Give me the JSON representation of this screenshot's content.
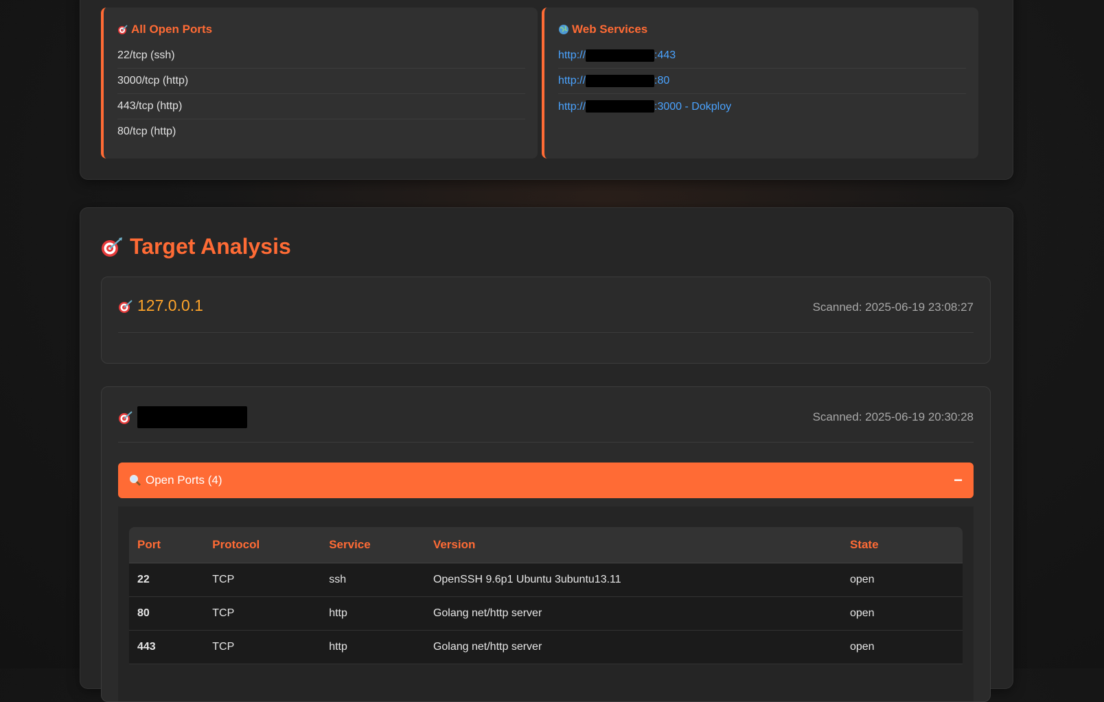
{
  "summary": {
    "ports_card": {
      "icon": "target-icon",
      "title": "All Open Ports",
      "items": [
        "22/tcp (ssh)",
        "3000/tcp (http)",
        "443/tcp (http)",
        "80/tcp (http)"
      ]
    },
    "web_card": {
      "icon": "globe-icon",
      "title": "Web Services",
      "items": [
        {
          "prefix": "http://",
          "suffix": ":443"
        },
        {
          "prefix": "http://",
          "suffix": ":80"
        },
        {
          "prefix": "http://",
          "suffix": ":3000 - Dokploy"
        }
      ]
    }
  },
  "analysis": {
    "title": "Target Analysis",
    "title_icon": "target-icon",
    "targets": [
      {
        "ip": "127.0.0.1",
        "scanned": "Scanned: 2025-06-19 23:08:27"
      },
      {
        "ip": "",
        "scanned": "Scanned: 2025-06-19 20:30:28"
      }
    ],
    "open_ports": {
      "label": "Open Ports (4)",
      "icon": "magnifier-icon",
      "toggle": "−",
      "columns": [
        "Port",
        "Protocol",
        "Service",
        "Version",
        "State"
      ],
      "rows": [
        [
          "22",
          "TCP",
          "ssh",
          "OpenSSH 9.6p1 Ubuntu 3ubuntu13.11",
          "open"
        ],
        [
          "80",
          "TCP",
          "http",
          "Golang net/http server",
          "open"
        ],
        [
          "443",
          "TCP",
          "http",
          "Golang net/http server",
          "open"
        ]
      ]
    }
  },
  "colors": {
    "accent": "#ff6b35",
    "ip": "#ffa42a",
    "link": "#4aa3ff",
    "state_open": "#2ec04a"
  }
}
